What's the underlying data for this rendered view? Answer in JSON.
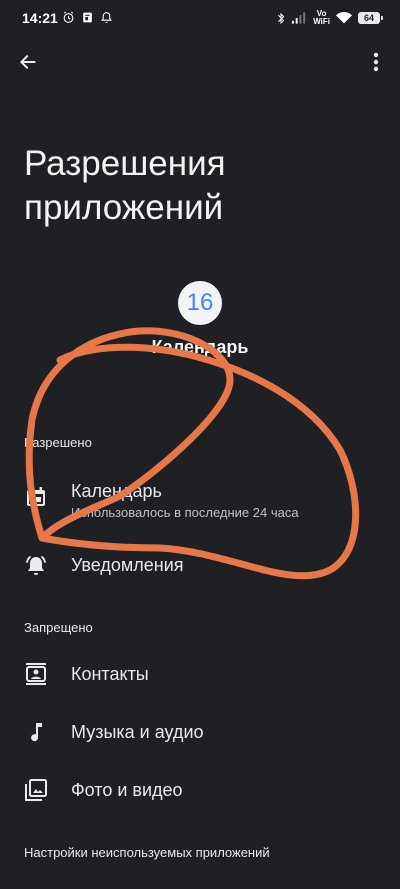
{
  "status_bar": {
    "time": "14:21",
    "network_line1": "Vo",
    "network_line2": "WiFi",
    "battery": "64"
  },
  "header": {
    "title": "Разрешения приложений"
  },
  "app": {
    "icon_text": "16",
    "name": "Календарь"
  },
  "sections": {
    "allowed": {
      "header": "Разрешено",
      "items": [
        {
          "label": "Календарь",
          "subtitle": "Использовалось в последние 24 часа",
          "icon": "calendar-icon"
        },
        {
          "label": "Уведомления",
          "icon": "bell-icon"
        }
      ]
    },
    "denied": {
      "header": "Запрещено",
      "items": [
        {
          "label": "Контакты",
          "icon": "contacts-icon"
        },
        {
          "label": "Музыка и аудио",
          "icon": "music-note-icon"
        },
        {
          "label": "Фото и видео",
          "icon": "photos-icon"
        }
      ]
    }
  },
  "footer": {
    "unused_apps_settings": "Настройки неиспользуемых приложений"
  },
  "colors": {
    "background": "#1f2024",
    "annotation_stroke": "#e57748",
    "app_icon_accent": "#4285f4"
  }
}
